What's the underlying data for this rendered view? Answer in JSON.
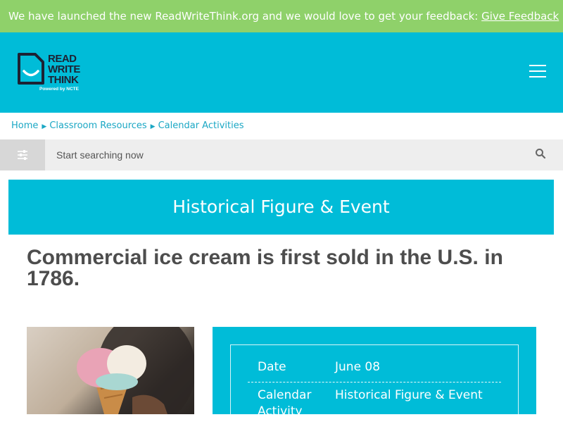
{
  "banner": {
    "text": "We have launched the new ReadWriteThink.org and we would love to get your feedback: ",
    "link": "Give Feedback"
  },
  "logo": {
    "line1": "READ",
    "line2": "WRITE",
    "line3": "THINK",
    "tagline": "Powered by NCTE"
  },
  "breadcrumb": [
    "Home",
    "Classroom Resources",
    "Calendar Activities"
  ],
  "search": {
    "placeholder": "Start searching now"
  },
  "page": {
    "category_title": "Historical Figure & Event",
    "headline": "Commercial ice cream is first sold in the U.S. in 1786."
  },
  "details": {
    "date_label": "Date",
    "date_value": "June 08",
    "activity_label": "Calendar Activity",
    "activity_value": "Historical Figure & Event"
  },
  "colors": {
    "banner": "#8fd16a",
    "brand": "#00bcd8",
    "link": "#1aa7c4",
    "heading": "#4d4d4d"
  },
  "icons": [
    "menu-icon",
    "filter-icon",
    "search-icon",
    "chevron-right-icon",
    "logo-smile-icon"
  ]
}
